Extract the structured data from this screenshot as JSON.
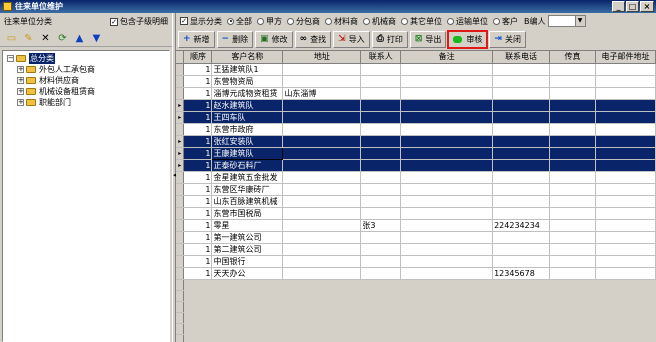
{
  "window": {
    "title": "往来单位维护"
  },
  "left": {
    "header": "往来单位分类",
    "include_children": "包含子级明细",
    "tree": [
      {
        "label": "总分类",
        "selected": true,
        "level": 0
      },
      {
        "label": "外包人工承包商",
        "level": 1
      },
      {
        "label": "材料供应商",
        "level": 1
      },
      {
        "label": "机械设备租赁商",
        "level": 1
      },
      {
        "label": "职能部门",
        "level": 1
      }
    ]
  },
  "filter": {
    "show_category": "显示分类",
    "options": [
      "全部",
      "甲方",
      "分包商",
      "材料商",
      "机械商",
      "其它单位",
      "运输单位",
      "客户"
    ],
    "selected": "全部",
    "code_label": "B编人"
  },
  "toolbar": {
    "new": "新增",
    "delete": "删除",
    "edit": "修改",
    "find": "查找",
    "import": "导入",
    "print": "打印",
    "export": "导出",
    "audit": "审核",
    "close": "关闭"
  },
  "grid": {
    "columns": [
      "顺序",
      "客户名称",
      "地址",
      "联系人",
      "备注",
      "联系电话",
      "传真",
      "电子邮件地址"
    ],
    "rows": [
      {
        "seq": "1",
        "name": "王猛建筑队1",
        "addr": "",
        "contact": "",
        "note": "",
        "phone": "",
        "fax": "",
        "email": "",
        "hl": false
      },
      {
        "seq": "1",
        "name": "东营物资局",
        "addr": "",
        "contact": "",
        "note": "",
        "phone": "",
        "fax": "",
        "email": "",
        "hl": false
      },
      {
        "seq": "1",
        "name": "淄博元成物资租赁",
        "addr": "山东淄博",
        "contact": "",
        "note": "",
        "phone": "",
        "fax": "",
        "email": "",
        "hl": false
      },
      {
        "seq": "1",
        "name": "赵水建筑队",
        "addr": "",
        "contact": "",
        "note": "",
        "phone": "",
        "fax": "",
        "email": "",
        "hl": true
      },
      {
        "seq": "1",
        "name": "王四车队",
        "addr": "",
        "contact": "",
        "note": "",
        "phone": "",
        "fax": "",
        "email": "",
        "hl": true
      },
      {
        "seq": "1",
        "name": "东营市政府",
        "addr": "",
        "contact": "",
        "note": "",
        "phone": "",
        "fax": "",
        "email": "",
        "hl": false
      },
      {
        "seq": "1",
        "name": "张红安装队",
        "addr": "",
        "contact": "",
        "note": "",
        "phone": "",
        "fax": "",
        "email": "",
        "hl": true
      },
      {
        "seq": "1",
        "name": "王康建筑队",
        "addr": "",
        "contact": "",
        "note": "",
        "phone": "",
        "fax": "",
        "email": "",
        "hl": true,
        "cur": true
      },
      {
        "seq": "1",
        "name": "正泰砂石料厂",
        "addr": "",
        "contact": "",
        "note": "",
        "phone": "",
        "fax": "",
        "email": "",
        "hl": true
      },
      {
        "seq": "1",
        "name": "金星建筑五金批发",
        "addr": "",
        "contact": "",
        "note": "",
        "phone": "",
        "fax": "",
        "email": "",
        "hl": false
      },
      {
        "seq": "1",
        "name": "东营区华康砖厂",
        "addr": "",
        "contact": "",
        "note": "",
        "phone": "",
        "fax": "",
        "email": "",
        "hl": false
      },
      {
        "seq": "1",
        "name": "山东百脉建筑机械",
        "addr": "",
        "contact": "",
        "note": "",
        "phone": "",
        "fax": "",
        "email": "",
        "hl": false
      },
      {
        "seq": "1",
        "name": "东营市国税局",
        "addr": "",
        "contact": "",
        "note": "",
        "phone": "",
        "fax": "",
        "email": "",
        "hl": false
      },
      {
        "seq": "1",
        "name": "零星",
        "addr": "",
        "contact": "张3",
        "note": "",
        "phone": "224234234",
        "fax": "",
        "email": "",
        "hl": false
      },
      {
        "seq": "1",
        "name": "第一建筑公司",
        "addr": "",
        "contact": "",
        "note": "",
        "phone": "",
        "fax": "",
        "email": "",
        "hl": false
      },
      {
        "seq": "1",
        "name": "第二建筑公司",
        "addr": "",
        "contact": "",
        "note": "",
        "phone": "",
        "fax": "",
        "email": "",
        "hl": false
      },
      {
        "seq": "1",
        "name": "中国银行",
        "addr": "",
        "contact": "",
        "note": "",
        "phone": "",
        "fax": "",
        "email": "",
        "hl": false
      },
      {
        "seq": "1",
        "name": "天天办公",
        "addr": "",
        "contact": "",
        "note": "",
        "phone": "12345678",
        "fax": "",
        "email": "",
        "hl": false
      }
    ],
    "empty_rows": 7
  }
}
